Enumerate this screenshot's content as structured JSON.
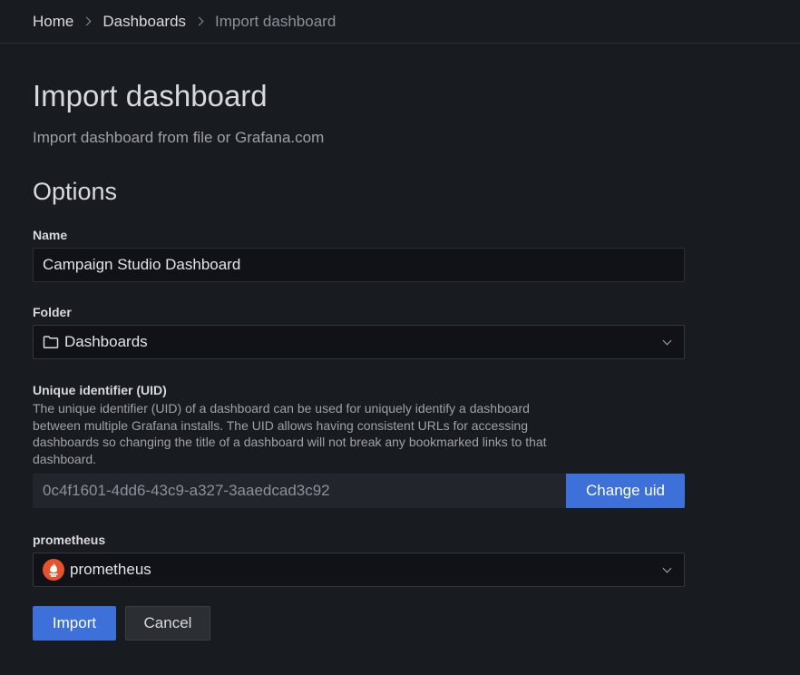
{
  "breadcrumb": {
    "items": [
      "Home",
      "Dashboards",
      "Import dashboard"
    ]
  },
  "page": {
    "title": "Import dashboard",
    "subtitle": "Import dashboard from file or Grafana.com"
  },
  "options": {
    "section_title": "Options",
    "name": {
      "label": "Name",
      "value": "Campaign Studio Dashboard"
    },
    "folder": {
      "label": "Folder",
      "value": "Dashboards",
      "icon": "folder-icon"
    },
    "uid": {
      "label": "Unique identifier (UID)",
      "description": "The unique identifier (UID) of a dashboard can be used for uniquely identify a dashboard between multiple Grafana installs. The UID allows having consistent URLs for accessing dashboards so changing the title of a dashboard will not break any bookmarked links to that dashboard.",
      "value": "0c4f1601-4dd6-43c9-a327-3aaedcad3c92",
      "change_button": "Change uid"
    },
    "datasource": {
      "label": "prometheus",
      "value": "prometheus",
      "icon": "prometheus-icon"
    }
  },
  "actions": {
    "import_label": "Import",
    "cancel_label": "Cancel"
  },
  "colors": {
    "background": "#181b1f",
    "primary": "#3d71d9",
    "prometheus": "#e6522c"
  }
}
